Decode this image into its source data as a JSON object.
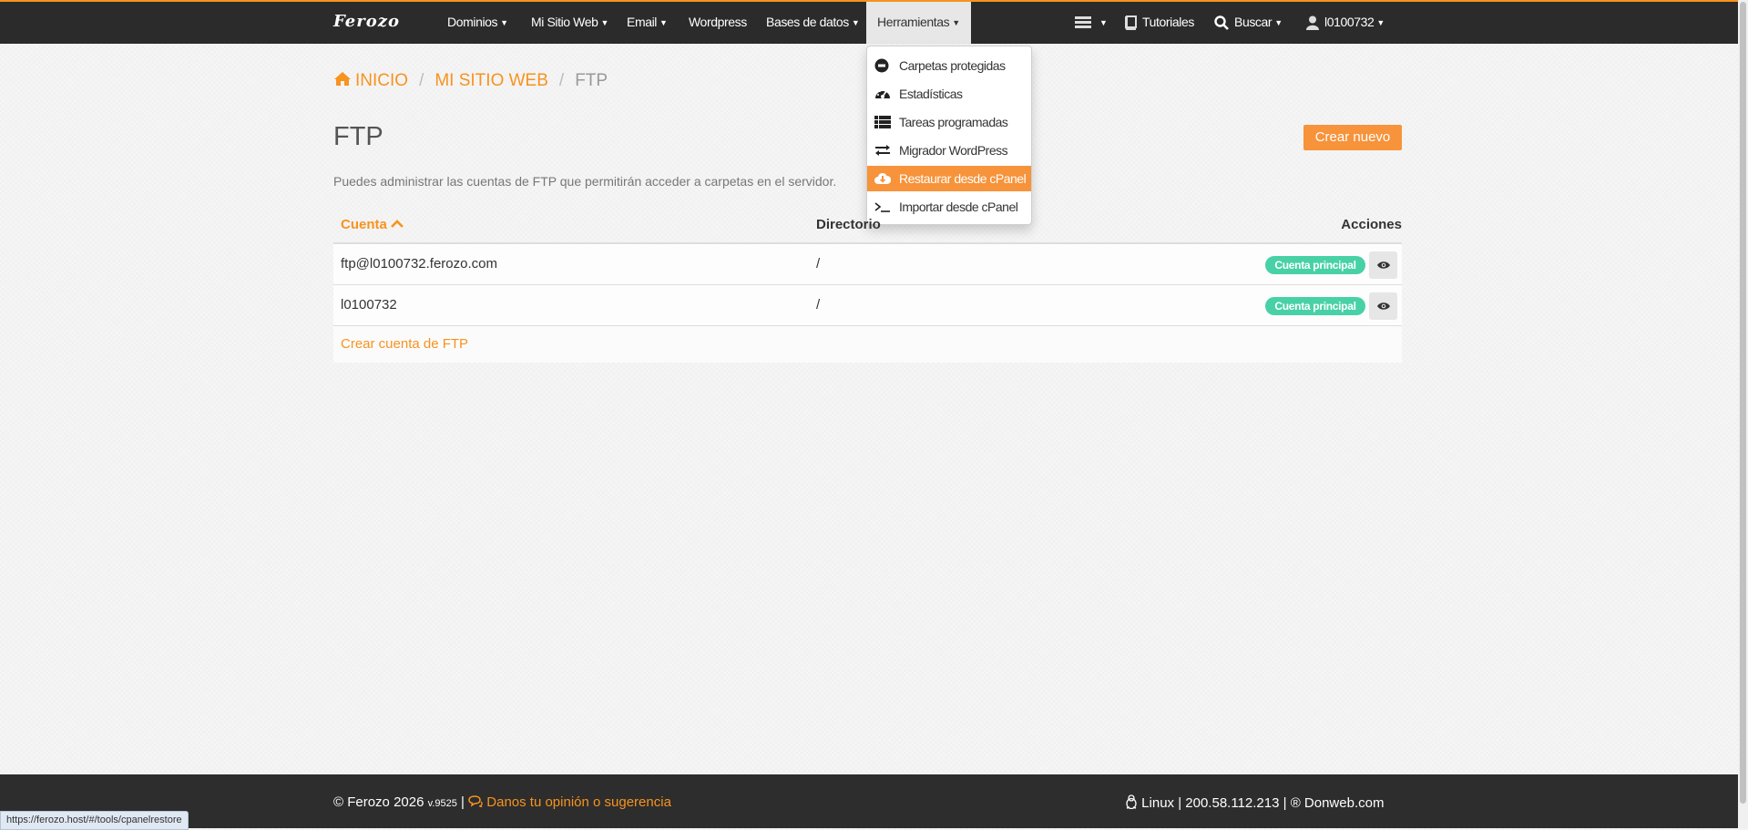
{
  "nav": {
    "brand": "Ferozo",
    "items": [
      {
        "label": "Dominios"
      },
      {
        "label": "Mi Sitio Web"
      },
      {
        "label": "Email"
      },
      {
        "label": "Wordpress"
      },
      {
        "label": "Bases de datos"
      },
      {
        "label": "Herramientas"
      }
    ],
    "tutorials": "Tutoriales",
    "search": "Buscar",
    "user": "l0100732"
  },
  "dropdown": {
    "items": [
      {
        "label": "Carpetas protegidas",
        "icon": "minus-circle-icon"
      },
      {
        "label": "Estadísticas",
        "icon": "dashboard-icon"
      },
      {
        "label": "Tareas programadas",
        "icon": "list-icon"
      },
      {
        "label": "Migrador WordPress",
        "icon": "exchange-icon"
      },
      {
        "label": "Restaurar desde cPanel",
        "icon": "cloud-download-icon",
        "highlighted": true
      },
      {
        "label": "Importar desde cPanel",
        "icon": "terminal-icon"
      }
    ]
  },
  "breadcrumb": {
    "home": "INICIO",
    "section": "MI SITIO WEB",
    "current": "FTP"
  },
  "page": {
    "title": "FTP",
    "create_button": "Crear nuevo",
    "description": "Puedes administrar las cuentas de FTP que permitirán acceder a carpetas en el servidor."
  },
  "table": {
    "headers": {
      "account": "Cuenta",
      "directory": "Directorio",
      "actions": "Acciones"
    },
    "rows": [
      {
        "account": "ftp@l0100732.ferozo.com",
        "directory": "/",
        "badge": "Cuenta principal"
      },
      {
        "account": "l0100732",
        "directory": "/",
        "badge": "Cuenta principal"
      }
    ],
    "create_link": "Crear cuenta de FTP"
  },
  "footer": {
    "copyright": "© Ferozo 2026",
    "version": "v.9525",
    "feedback": "Danos tu opinión o sugerencia",
    "os": "Linux",
    "ip": "200.58.112.213",
    "provider": "® Donweb.com"
  },
  "status_bar": {
    "url": "https://ferozo.host/#/tools/cpanelrestore"
  },
  "colors": {
    "accent": "#f7931e",
    "navbar": "#2b2b2b",
    "badge": "#48d1a6"
  }
}
